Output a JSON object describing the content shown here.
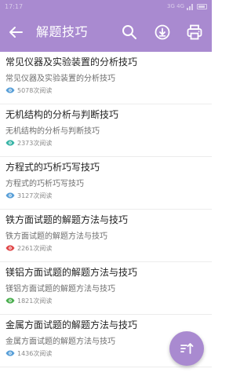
{
  "status_bar": {
    "time": "17:17",
    "network": "3G 4G"
  },
  "toolbar": {
    "title": "解题技巧",
    "accent_color": "#a98ad0",
    "icons": [
      "back-arrow-icon",
      "search-icon",
      "download-icon",
      "print-icon"
    ]
  },
  "articles": [
    {
      "title": "常见仪器及实验装置的分析技巧",
      "summary": "常见仪器及实验装置的分析技巧",
      "reads": "5078次阅读",
      "eye_color": "#5aa0d8"
    },
    {
      "title": "无机结构的分析与判断技巧",
      "summary": "无机结构的分析与判断技巧",
      "reads": "2373次阅读",
      "eye_color": "#3ab5a7"
    },
    {
      "title": "方程式的巧析巧写技巧",
      "summary": "方程式的巧析巧写技巧",
      "reads": "3127次阅读",
      "eye_color": "#5aa0d8"
    },
    {
      "title": "铁方面试题的解题方法与技巧",
      "summary": "铁方面试题的解题方法与技巧",
      "reads": "2261次阅读",
      "eye_color": "#e0484a"
    },
    {
      "title": "镁铝方面试题的解题方法与技巧",
      "summary": "镁铝方面试题的解题方法与技巧",
      "reads": "1821次阅读",
      "eye_color": "#4caf50"
    },
    {
      "title": "金属方面试题的解题方法与技巧",
      "summary": "金属方面试题的解题方法与技巧",
      "reads": "1436次阅读",
      "eye_color": "#5aa0d8"
    }
  ],
  "fab": {
    "icon": "sort-icon"
  }
}
